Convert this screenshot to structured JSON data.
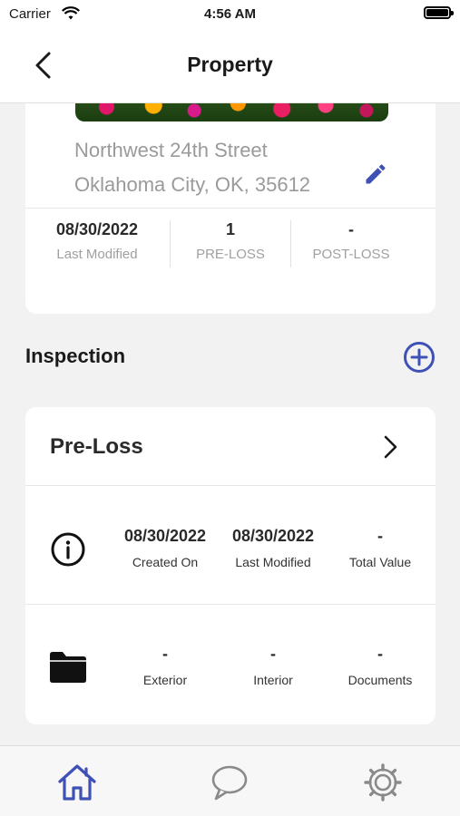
{
  "status_bar": {
    "carrier": "Carrier",
    "time": "4:56 AM"
  },
  "nav": {
    "title": "Property"
  },
  "property": {
    "address_line1": "Northwest 24th Street",
    "address_line2": "Oklahoma City, OK, 35612",
    "stats": [
      {
        "value": "08/30/2022",
        "label": "Last Modified"
      },
      {
        "value": "1",
        "label": "PRE-LOSS"
      },
      {
        "value": "-",
        "label": "POST-LOSS"
      }
    ]
  },
  "inspection": {
    "section_title": "Inspection",
    "card": {
      "title": "Pre-Loss",
      "info_row": [
        {
          "value": "08/30/2022",
          "label": "Created On"
        },
        {
          "value": "08/30/2022",
          "label": "Last Modified"
        },
        {
          "value": "-",
          "label": "Total Value"
        }
      ],
      "folder_row": [
        {
          "value": "-",
          "label": "Exterior"
        },
        {
          "value": "-",
          "label": "Interior"
        },
        {
          "value": "-",
          "label": "Documents"
        }
      ]
    }
  },
  "tabs": [
    {
      "icon": "home-icon",
      "active": true
    },
    {
      "icon": "chat-icon",
      "active": false
    },
    {
      "icon": "settings-icon",
      "active": false
    }
  ],
  "colors": {
    "accent": "#3f51b5",
    "inactive": "#8a8a8a"
  }
}
